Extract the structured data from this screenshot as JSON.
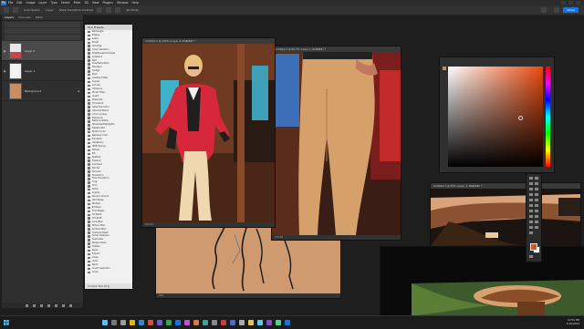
{
  "menu": {
    "logo": "Ps",
    "items": [
      "File",
      "Edit",
      "Image",
      "Layer",
      "Type",
      "Select",
      "Filter",
      "3D",
      "View",
      "Plugins",
      "Window",
      "Help"
    ]
  },
  "options_bar": {
    "auto_select": "Auto-Select:",
    "target": "Layer",
    "transform": "Show Transform Controls",
    "mode": "3D Mode:",
    "share": "Share"
  },
  "layers_panel": {
    "tabs": [
      "Layers",
      "Channels",
      "Paths"
    ],
    "layers": [
      {
        "name": "Layer 2",
        "selected": true
      },
      {
        "name": "Layer 1",
        "selected": false
      },
      {
        "name": "Background",
        "selected": false
      }
    ]
  },
  "actions_panel": {
    "title": "Tool Presets",
    "items": [
      "Rectangle",
      "Ellipse",
      "Lasso",
      "Brush",
      "Smudge",
      "Color Variation",
      "Brightness/Contrast",
      "Gradient",
      "Blur",
      "Hue/Saturation",
      "Sharpen",
      "Dodge",
      "Burn",
      "Gradient Map",
      "Levels",
      "Curves",
      "Vibrance",
      "Photo Filter",
      "Invert",
      "Posterize",
      "Threshold",
      "Selective Color",
      "Channel Mixer",
      "Color Lookup",
      "Exposure",
      "Black & White",
      "Shadows/Highlights",
      "Desaturate",
      "Match Color",
      "Replace Color",
      "Equalize",
      "Variations",
      "HDR Toning",
      "Stroke",
      "Fill",
      "Feather",
      "Expand",
      "Contract",
      "Border",
      "Smooth",
      "Transform",
      "Free Transform",
      "Crop",
      "Trim",
      "Warp",
      "Liquify",
      "Render Clouds",
      "Add Noise",
      "Median",
      "Emboss",
      "Find Edges",
      "Oil Paint",
      "Tilt-Shift",
      "Lens Blur",
      "Motion Blur",
      "Surface Blur",
      "Unsharp Mask",
      "Smart Sharpen",
      "Duplicate",
      "Merge Down",
      "Flatten",
      "Save",
      "Export",
      "Close",
      "Undo",
      "Redo",
      "Invert Selection",
      "Grow"
    ],
    "footer": "Current Tool Only"
  },
  "windows": {
    "front": {
      "title": "Untitled-1 @ 100% (Layer 2, RGB/8#) *",
      "status": "33.33%"
    },
    "pants": {
      "title": "Untitled-2 @ 66.7% (Layer 1, RGB/8#) *",
      "status": "33.33%"
    },
    "sketch": {
      "status": "33%"
    },
    "hat": {
      "title": "Untitled-3 @ 50% (Layer 1, RGB/8#) *"
    }
  },
  "taskbar": {
    "time": "12:51 PM",
    "date": "1/16/2024"
  },
  "colors": {
    "accent": "#1473e6",
    "foreground": "#c25a2a",
    "background": "#ffffff"
  }
}
